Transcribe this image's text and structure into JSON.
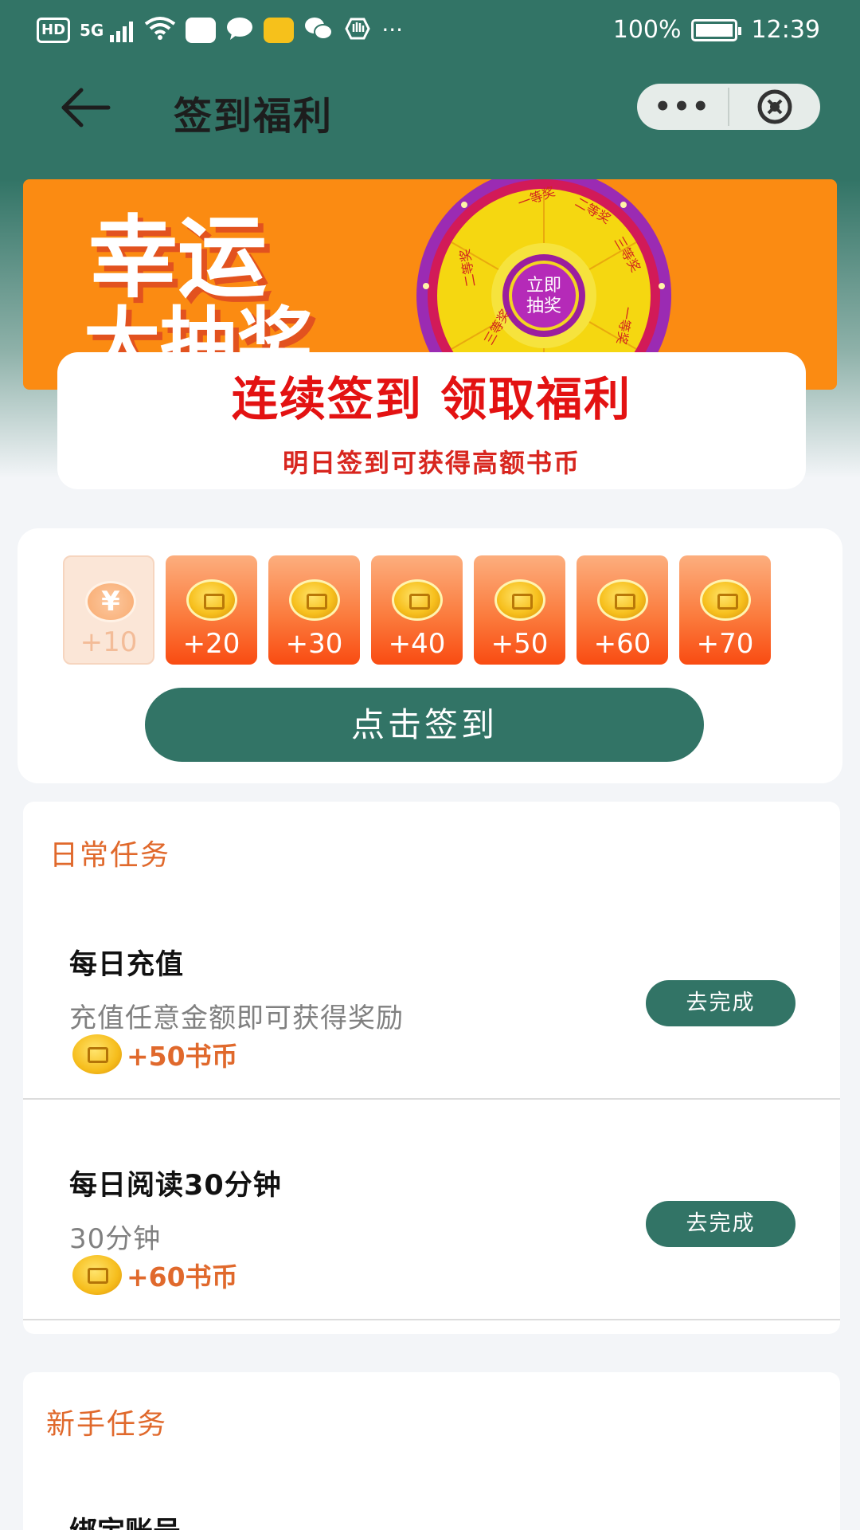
{
  "status_bar": {
    "hd": "HD",
    "signal": "5G",
    "more": "···",
    "battery_pct": "100%",
    "time": "12:39"
  },
  "nav": {
    "title": "签到福利",
    "more_label": "•••"
  },
  "banner": {
    "line1": "幸运",
    "line2": "大抽奖",
    "wheel_center": [
      "立即",
      "抽奖"
    ],
    "wheel_prizes": [
      "一等奖",
      "二等奖",
      "三等奖",
      "一等奖",
      "二等奖",
      "三等奖"
    ]
  },
  "hero": {
    "title": "连续签到 领取福利",
    "subtitle": "明日签到可获得高额书币"
  },
  "checkin": {
    "days": [
      {
        "value": "+10",
        "claimed": true
      },
      {
        "value": "+20",
        "claimed": false
      },
      {
        "value": "+30",
        "claimed": false
      },
      {
        "value": "+40",
        "claimed": false
      },
      {
        "value": "+50",
        "claimed": false
      },
      {
        "value": "+60",
        "claimed": false
      },
      {
        "value": "+70",
        "claimed": false
      }
    ],
    "button": "点击签到"
  },
  "daily": {
    "title": "日常任务",
    "tasks": [
      {
        "name": "每日充值",
        "desc": "充值任意金额即可获得奖励",
        "reward": "+50书币",
        "button": "去完成"
      },
      {
        "name": "每日阅读30分钟",
        "desc": "30分钟",
        "reward": "+60书币",
        "button": "去完成"
      }
    ]
  },
  "newbie": {
    "title": "新手任务",
    "tasks": [
      {
        "name": "绑定账号"
      }
    ]
  },
  "colors": {
    "primary": "#327466",
    "banner_orange": "#fb8b12",
    "hero_red": "#e31212",
    "accent_orange": "#e0692c"
  }
}
